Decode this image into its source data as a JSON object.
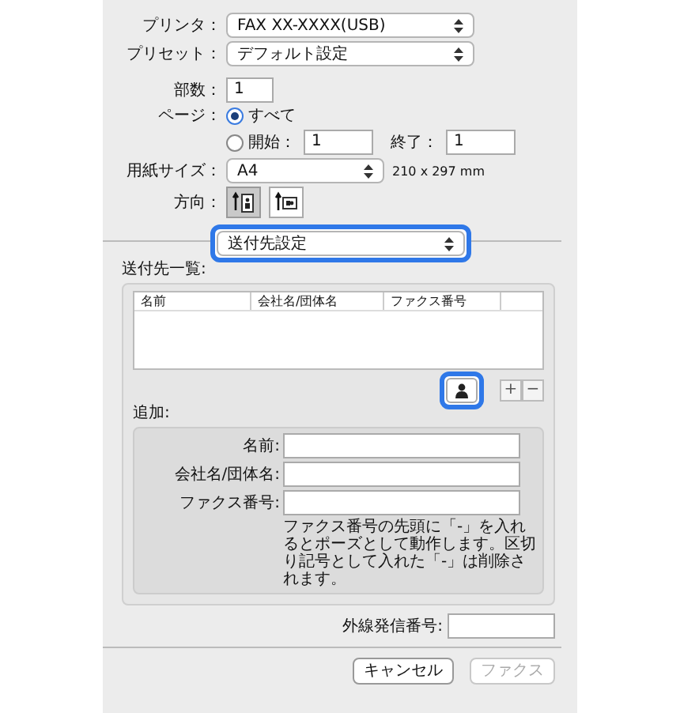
{
  "printer": {
    "label": "プリンタ：",
    "value": "FAX XX-XXXX(USB)"
  },
  "preset": {
    "label": "プリセット：",
    "value": "デフォルト設定"
  },
  "copies": {
    "label": "部数：",
    "value": "1"
  },
  "pages": {
    "label": "ページ：",
    "options": [
      {
        "label": "すべて",
        "selected": true
      },
      {
        "label": "開始：",
        "selected": false
      }
    ],
    "from": "1",
    "to_label": "終了：",
    "to": "1"
  },
  "paper_size": {
    "label": "用紙サイズ：",
    "value": "A4",
    "dimensions": "210 x 297 mm"
  },
  "orientation": {
    "label": "方向：",
    "options": [
      {
        "kind": "portrait",
        "selected": true
      },
      {
        "kind": "landscape",
        "selected": false
      }
    ]
  },
  "section_popup": {
    "value": "送付先設定",
    "highlighted": true
  },
  "recipients": {
    "label": "送付先一覧:",
    "columns": [
      "名前",
      "会社名/団体名",
      "ファクス番号"
    ]
  },
  "address_book_button": {
    "highlighted": true
  },
  "list_buttons": [
    "+",
    "−"
  ],
  "add": {
    "label": "追加:",
    "fields": [
      {
        "label": "名前:"
      },
      {
        "label": "会社名/団体名:"
      },
      {
        "label": "ファクス番号:"
      }
    ],
    "note": "ファクス番号の先頭に「-」を入れるとポーズとして動作します。区切り記号として入れた「-」は削除されます。"
  },
  "outside_line": {
    "label": "外線発信番号:"
  },
  "buttons": [
    {
      "label": "キャンセル",
      "disabled": false
    },
    {
      "label": "ファクス",
      "disabled": true
    }
  ]
}
